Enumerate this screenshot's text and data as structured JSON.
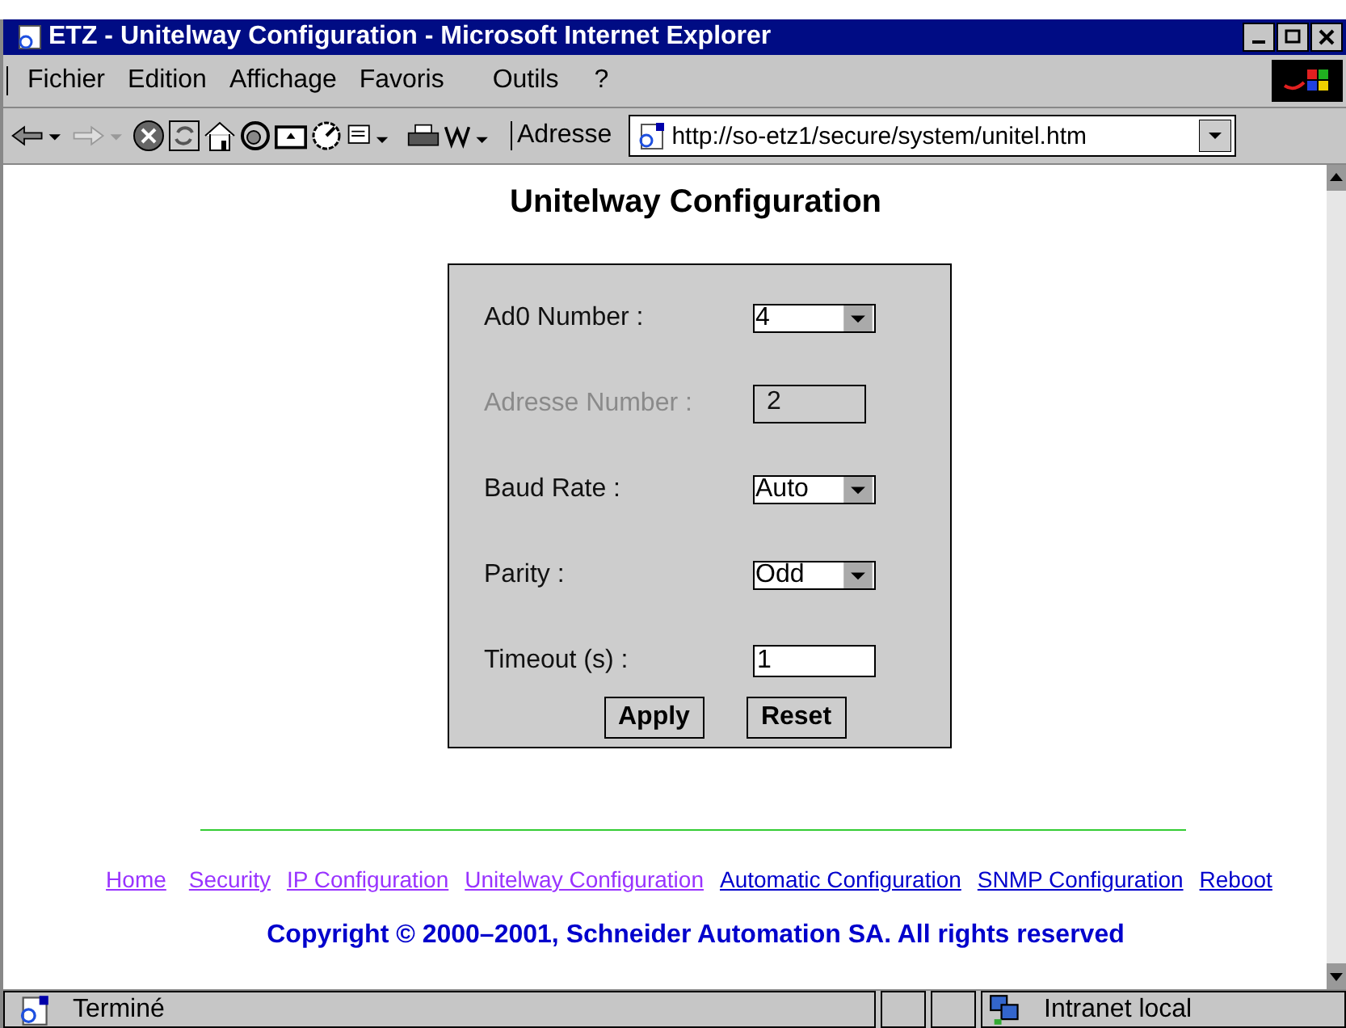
{
  "window": {
    "title": "ETZ - Unitelway Configuration - Microsoft Internet Explorer"
  },
  "menu": [
    {
      "label": "Fichier"
    },
    {
      "label": "Edition"
    },
    {
      "label": "Affichage"
    },
    {
      "label": "Favoris"
    },
    {
      "label": "Outils"
    },
    {
      "label": "?"
    }
  ],
  "address": {
    "label": "Adresse",
    "value": "http://so-etz1/secure/system/unitel.htm"
  },
  "page": {
    "heading": "Unitelway Configuration",
    "fields": [
      {
        "label": "Ad0 Number :",
        "kind": "select",
        "value": "4",
        "disabled": false
      },
      {
        "label": "Adresse Number :",
        "kind": "text",
        "value": "2",
        "disabled": true
      },
      {
        "label": "Baud Rate :",
        "kind": "select",
        "value": "Auto",
        "disabled": false
      },
      {
        "label": "Parity :",
        "kind": "select",
        "value": "Odd",
        "disabled": false
      },
      {
        "label": "Timeout (s) :",
        "kind": "text",
        "value": "1",
        "disabled": false
      }
    ],
    "buttons": [
      "Apply",
      "Reset"
    ],
    "links": [
      {
        "label": "Home",
        "visited": true
      },
      {
        "label": "Security",
        "visited": true
      },
      {
        "label": "IP Configuration",
        "visited": true
      },
      {
        "label": "Unitelway Configuration",
        "visited": true
      },
      {
        "label": "Automatic Configuration",
        "visited": false
      },
      {
        "label": "SNMP Configuration",
        "visited": false
      },
      {
        "label": "Reboot",
        "visited": false
      }
    ],
    "copyright": "Copyright © 2000–2001, Schneider Automation SA. All rights reserved"
  },
  "status_bar": {
    "text": "Terminé",
    "zone": "Intranet local"
  }
}
